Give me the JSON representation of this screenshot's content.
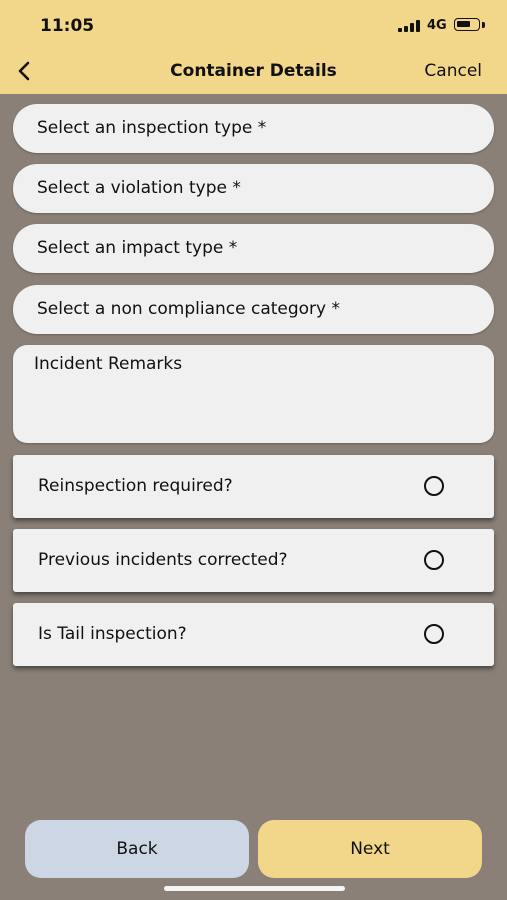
{
  "status_bar": {
    "time": "11:05",
    "network": "4G"
  },
  "nav": {
    "title": "Container Details",
    "cancel_label": "Cancel"
  },
  "form": {
    "inspection_type": "Select an inspection type *",
    "violation_type": "Select a violation type *",
    "impact_type": "Select an impact type *",
    "non_compliance_category": "Select a non compliance category *",
    "remarks_placeholder": "Incident Remarks"
  },
  "toggles": [
    {
      "label": "Reinspection required?",
      "selected": false
    },
    {
      "label": "Previous incidents corrected?",
      "selected": false
    },
    {
      "label": "Is Tail inspection?",
      "selected": false
    }
  ],
  "footer": {
    "back_label": "Back",
    "next_label": "Next"
  },
  "colors": {
    "header_bg": "#f2d68a",
    "page_bg": "#8a8078",
    "back_button": "#cdd6e4",
    "next_button": "#f2d68a"
  },
  "icons": {
    "back": "chevron-left-icon",
    "radio": "radio-unselected-icon"
  }
}
